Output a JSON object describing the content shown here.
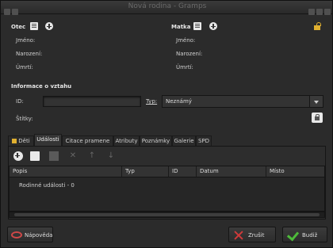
{
  "window": {
    "title": "Nová rodina - Gramps"
  },
  "father": {
    "heading": "Otec",
    "fields": [
      "Jméno:",
      "Narození:",
      "Úmrtí:"
    ]
  },
  "mother": {
    "heading": "Matka",
    "fields": [
      "Jméno:",
      "Narození:",
      "Úmrtí:"
    ]
  },
  "relation": {
    "heading": "Informace o vztahu",
    "id_label": "ID:",
    "id_value": "",
    "type_label": "Typ:",
    "type_value": "Neznámý",
    "tags_label": "Štítky:"
  },
  "tabs": [
    {
      "label": "Děti",
      "active": false
    },
    {
      "label": "Události",
      "active": true
    },
    {
      "label": "Citace pramene",
      "active": false
    },
    {
      "label": "Atributy",
      "active": false
    },
    {
      "label": "Poznámky",
      "active": false
    },
    {
      "label": "Galerie",
      "active": false
    },
    {
      "label": "SPD",
      "active": false
    }
  ],
  "events_table": {
    "columns": [
      "Popis",
      "Typ",
      "ID",
      "Datum",
      "Místo"
    ],
    "rows": [
      {
        "label": "Rodinné události - 0"
      }
    ]
  },
  "buttons": {
    "help": "Nápověda",
    "cancel": "Zrušit",
    "ok": "Budiž"
  },
  "colors": {
    "background": "#2b2b2b",
    "cancel_icon": "#d03a3a",
    "ok_icon": "#4dbb3a",
    "help_icon": "#d04848"
  }
}
